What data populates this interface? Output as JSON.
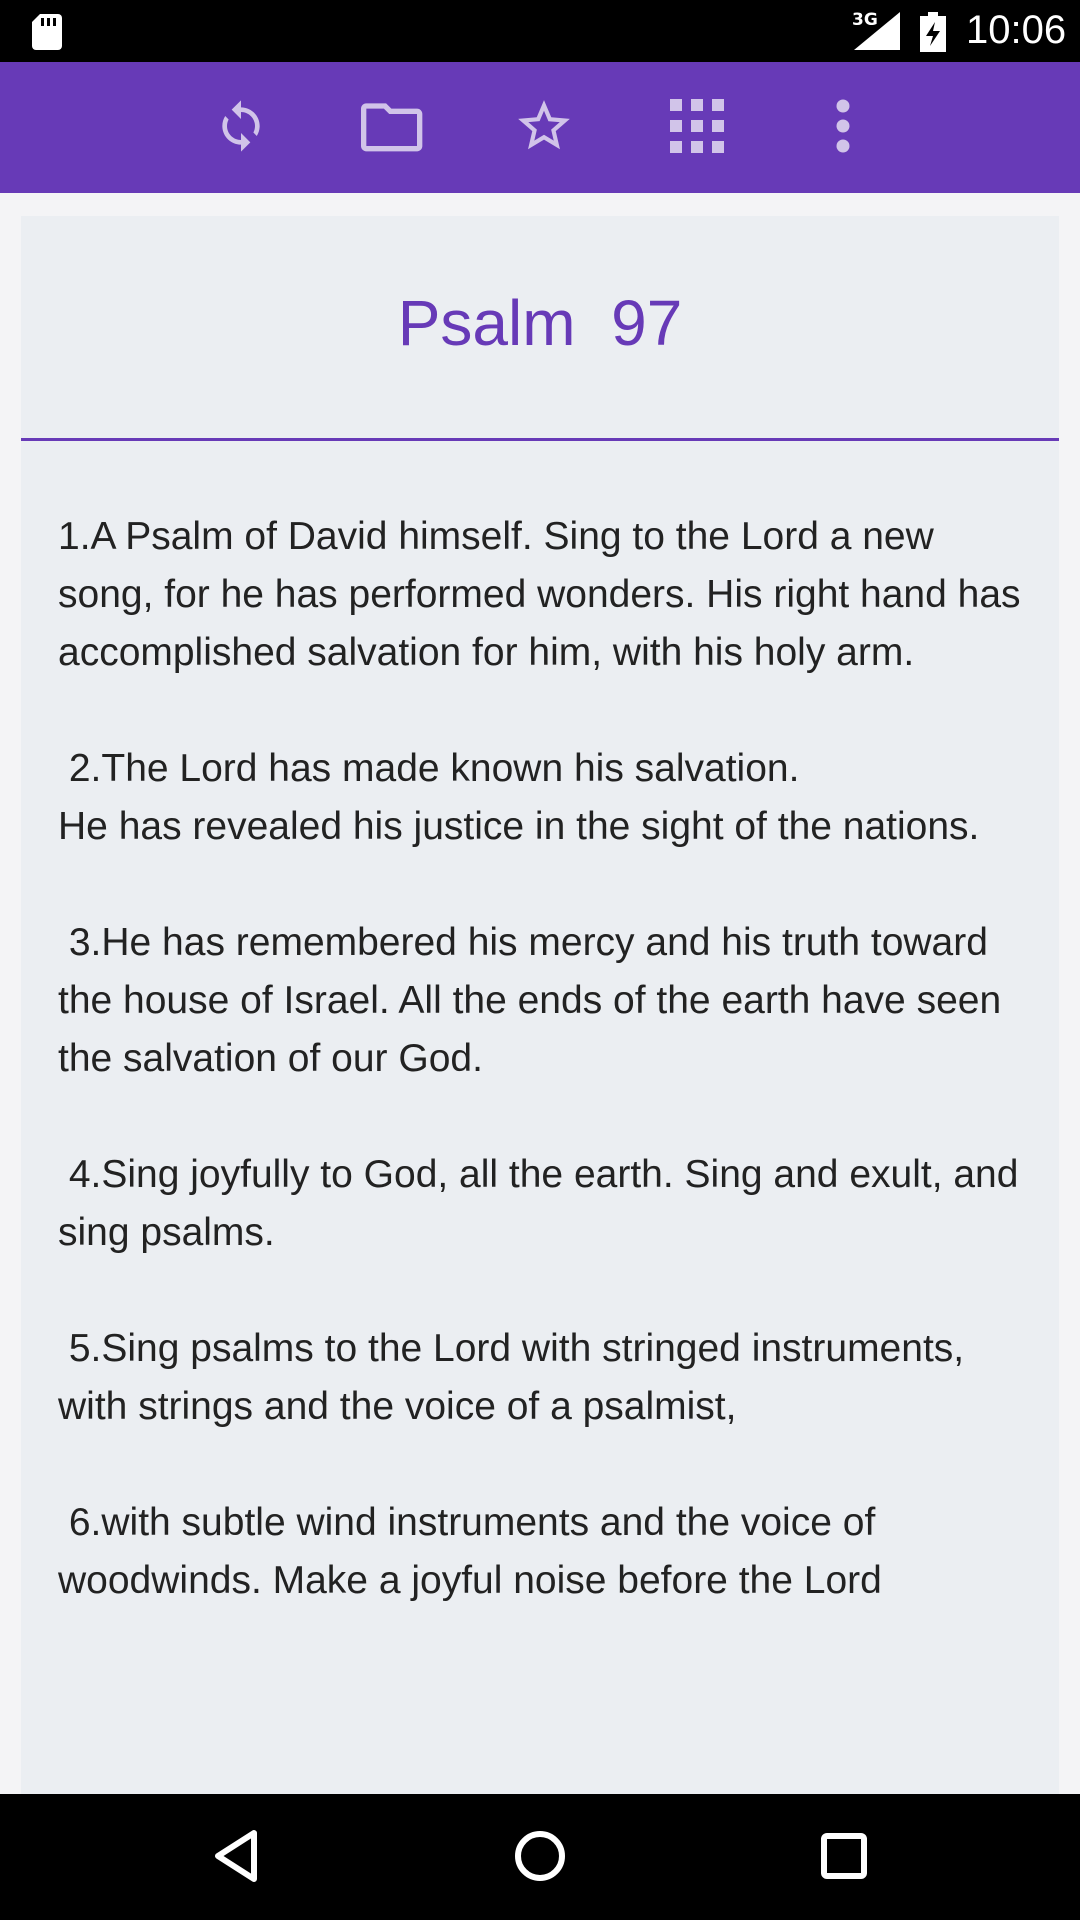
{
  "status_bar": {
    "network_type": "3G",
    "time": "10:06",
    "icons": [
      "sd-card-icon",
      "signal-icon",
      "battery-charging-icon"
    ]
  },
  "toolbar": {
    "background": "#673ab7",
    "actions": [
      "refresh-icon",
      "folder-icon",
      "star-icon",
      "grid-icon",
      "more-vert-icon"
    ]
  },
  "content": {
    "title": "Psalm  97",
    "accent_color": "#673ab7",
    "verses": [
      "1.A Psalm of David himself. Sing to the Lord a new song, for he has performed wonders. His right hand has accomplished salvation for him, with his holy arm.",
      " 2.The Lord has made known his salvation.\nHe has revealed his justice in the sight of the nations.",
      " 3.He has remembered his mercy and his truth toward the house of Israel. All the ends of the earth have seen the salvation of our God.",
      " 4.Sing joyfully to God, all the earth. Sing and exult, and sing psalms.",
      " 5.Sing psalms to the Lord with stringed instruments, with strings and the voice of a psalmist,",
      " 6.with subtle wind instruments and the voice of woodwinds. Make a joyful noise before the Lord"
    ]
  },
  "nav_bar": {
    "buttons": [
      "back-icon",
      "home-icon",
      "recents-icon"
    ]
  }
}
